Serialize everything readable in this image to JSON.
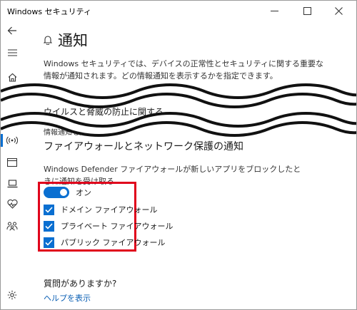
{
  "window": {
    "title": "Windows セキュリティ"
  },
  "page": {
    "title": "通知",
    "description": "Windows セキュリティでは、デバイスの正常性とセキュリティに関する重要な情報が通知されます。どの情報通知を表示するかを指定できます。"
  },
  "clipped": {
    "virus_heading": "ウイルスと脅威の防止に関する",
    "info_text": "情報通知を受け取る"
  },
  "firewall": {
    "heading": "ファイアウォールとネットワーク保護の通知",
    "description": "Windows Defender ファイアウォールが新しいアプリをブロックしたときに通知を受け取る",
    "toggle_label": "オン",
    "toggle_state": "on",
    "checkboxes": [
      {
        "label": "ドメイン ファイアウォール",
        "checked": true
      },
      {
        "label": "プライベート ファイアウォール",
        "checked": true
      },
      {
        "label": "パブリック ファイアウォール",
        "checked": true
      }
    ]
  },
  "help": {
    "question": "質問がありますか?",
    "link": "ヘルプを表示"
  },
  "colors": {
    "accent": "#0a6fd1",
    "highlight": "#e0001b",
    "link": "#0a5fb4"
  }
}
